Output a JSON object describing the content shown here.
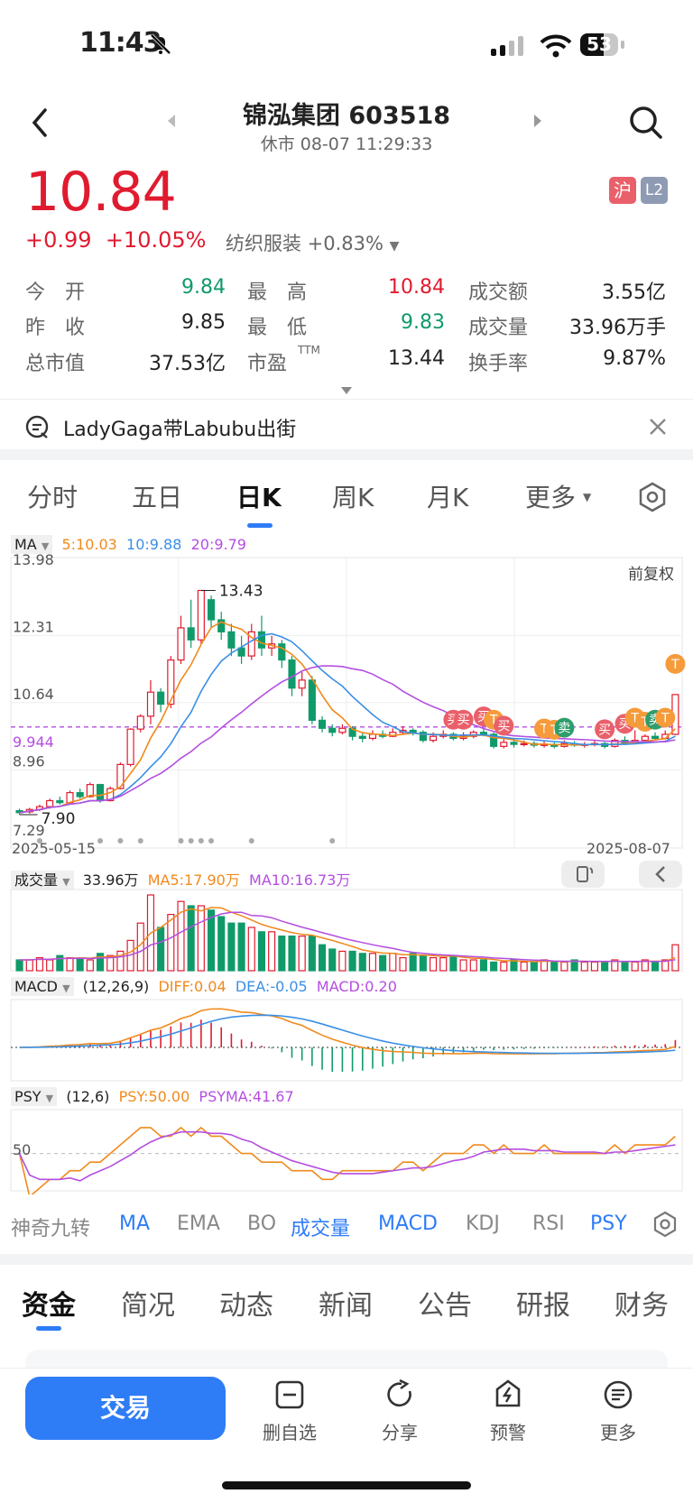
{
  "status": {
    "time": "11:43",
    "battery": "53"
  },
  "header": {
    "title": "锦泓集团 603518",
    "subtitle": "休市 08-07 11:29:33"
  },
  "quote": {
    "price": "10.84",
    "change": "+0.99",
    "change_pct": "+10.05%",
    "sector": "纺织服装 +0.83%",
    "badge_exchange": "沪",
    "badge_level": "L2",
    "rows": [
      [
        {
          "label": "今　开",
          "value": "9.84",
          "color": "green"
        },
        {
          "label": "最　高",
          "value": "10.84",
          "color": "red"
        },
        {
          "label": "成交额",
          "value": "3.55亿",
          "color": "dark"
        }
      ],
      [
        {
          "label": "昨　收",
          "value": "9.85",
          "color": "dark"
        },
        {
          "label": "最　低",
          "value": "9.83",
          "color": "green"
        },
        {
          "label": "成交量",
          "value": "33.96万手",
          "color": "dark"
        }
      ],
      [
        {
          "label": "总市值",
          "value": "37.53亿",
          "color": "dark"
        },
        {
          "label": "市盈",
          "value": "13.44",
          "color": "dark",
          "sup": "TTM"
        },
        {
          "label": "换手率",
          "value": "9.87%",
          "color": "dark"
        }
      ]
    ]
  },
  "notice": {
    "text": "LadyGaga带Labubu出街"
  },
  "period_tabs": [
    "分时",
    "五日",
    "日K",
    "周K",
    "月K",
    "更多"
  ],
  "active_tab_index": 2,
  "chart_data": {
    "type": "candlestick",
    "x_start": "2025-05-15",
    "x_end": "2025-08-07",
    "ma_legend": {
      "label": "MA",
      "ma5": "5:10.03",
      "ma10": "10:9.88",
      "ma20": "20:9.79"
    },
    "adjust_label": "前复权",
    "y_ticks": [
      "13.98",
      "12.31",
      "10.64",
      "8.96",
      "7.29"
    ],
    "prev_close_label": "9.944",
    "high_label": "13.43",
    "low_label": "7.90",
    "ylim": [
      7.29,
      13.98
    ],
    "candles": [
      [
        7.95,
        7.9,
        8.0,
        7.85
      ],
      [
        7.92,
        7.98,
        8.02,
        7.88
      ],
      [
        7.98,
        8.05,
        8.1,
        7.94
      ],
      [
        8.05,
        8.2,
        8.25,
        8.0
      ],
      [
        8.2,
        8.15,
        8.3,
        8.1
      ],
      [
        8.15,
        8.4,
        8.45,
        8.12
      ],
      [
        8.4,
        8.3,
        8.5,
        8.25
      ],
      [
        8.3,
        8.6,
        8.65,
        8.28
      ],
      [
        8.6,
        8.2,
        8.62,
        8.15
      ],
      [
        8.2,
        8.5,
        8.55,
        8.18
      ],
      [
        8.5,
        9.1,
        9.15,
        8.48
      ],
      [
        9.1,
        9.98,
        10.0,
        9.05
      ],
      [
        9.98,
        10.3,
        10.35,
        9.9
      ],
      [
        10.3,
        10.9,
        11.2,
        10.1
      ],
      [
        10.9,
        10.6,
        11.0,
        10.4
      ],
      [
        10.6,
        11.7,
        11.8,
        10.5
      ],
      [
        11.7,
        12.5,
        12.8,
        11.6
      ],
      [
        12.5,
        12.2,
        13.2,
        12.0
      ],
      [
        12.2,
        13.43,
        13.43,
        12.1
      ],
      [
        13.2,
        12.7,
        13.3,
        12.5
      ],
      [
        12.7,
        12.4,
        12.9,
        12.2
      ],
      [
        12.4,
        12.0,
        12.6,
        11.8
      ],
      [
        12.0,
        11.8,
        12.3,
        11.6
      ],
      [
        11.8,
        12.4,
        12.6,
        11.7
      ],
      [
        12.4,
        12.0,
        12.8,
        11.8
      ],
      [
        12.0,
        12.1,
        12.3,
        11.8
      ],
      [
        12.1,
        11.7,
        12.2,
        11.5
      ],
      [
        11.7,
        11.0,
        11.8,
        10.8
      ],
      [
        11.0,
        11.2,
        11.4,
        10.8
      ],
      [
        11.2,
        10.2,
        11.3,
        10.1
      ],
      [
        10.2,
        10.0,
        10.3,
        9.9
      ],
      [
        10.0,
        9.9,
        10.1,
        9.8
      ],
      [
        9.9,
        10.0,
        10.1,
        9.85
      ],
      [
        10.0,
        9.8,
        10.05,
        9.7
      ],
      [
        9.8,
        9.75,
        9.9,
        9.65
      ],
      [
        9.75,
        9.85,
        9.95,
        9.7
      ],
      [
        9.85,
        9.8,
        9.95,
        9.75
      ],
      [
        9.8,
        9.9,
        10.0,
        9.78
      ],
      [
        9.9,
        9.95,
        10.05,
        9.85
      ],
      [
        9.95,
        9.9,
        10.0,
        9.82
      ],
      [
        9.9,
        9.7,
        9.95,
        9.65
      ],
      [
        9.7,
        9.8,
        9.9,
        9.65
      ],
      [
        9.8,
        9.85,
        9.95,
        9.75
      ],
      [
        9.85,
        9.75,
        9.9,
        9.7
      ],
      [
        9.75,
        9.8,
        9.9,
        9.7
      ],
      [
        9.8,
        9.9,
        9.95,
        9.75
      ],
      [
        9.9,
        9.85,
        9.98,
        9.8
      ],
      [
        9.85,
        9.55,
        9.9,
        9.5
      ],
      [
        9.55,
        9.65,
        9.75,
        9.5
      ],
      [
        9.65,
        9.6,
        9.7,
        9.52
      ],
      [
        9.6,
        9.62,
        9.7,
        9.55
      ],
      [
        9.62,
        9.58,
        9.68,
        9.52
      ],
      [
        9.58,
        9.6,
        9.68,
        9.52
      ],
      [
        9.6,
        9.55,
        9.65,
        9.5
      ],
      [
        9.55,
        9.62,
        9.7,
        9.52
      ],
      [
        9.62,
        9.58,
        9.68,
        9.54
      ],
      [
        9.58,
        9.6,
        9.66,
        9.52
      ],
      [
        9.6,
        9.62,
        9.7,
        9.55
      ],
      [
        9.62,
        9.55,
        9.66,
        9.5
      ],
      [
        9.55,
        9.7,
        9.75,
        9.52
      ],
      [
        9.7,
        9.62,
        9.8,
        9.58
      ],
      [
        9.62,
        9.7,
        9.95,
        9.6
      ],
      [
        9.7,
        9.8,
        9.85,
        9.65
      ],
      [
        9.8,
        9.75,
        9.9,
        9.7
      ],
      [
        9.75,
        9.85,
        9.95,
        9.72
      ],
      [
        9.85,
        10.84,
        10.84,
        9.83
      ]
    ],
    "trade_markers": [
      {
        "i": 43,
        "label": "买",
        "color": "#e9606a"
      },
      {
        "i": 44,
        "label": "买",
        "color": "#e9606a"
      },
      {
        "i": 46,
        "label": "买",
        "color": "#e9606a"
      },
      {
        "i": 47,
        "label": "T",
        "color": "#f59b3b"
      },
      {
        "i": 48,
        "label": "买",
        "color": "#e9606a"
      },
      {
        "i": 52,
        "label": "T",
        "color": "#f59b3b"
      },
      {
        "i": 53,
        "label": "T",
        "color": "#f59b3b"
      },
      {
        "i": 54,
        "label": "卖",
        "color": "#2e9e6b"
      },
      {
        "i": 58,
        "label": "买",
        "color": "#e9606a"
      },
      {
        "i": 60,
        "label": "买",
        "color": "#e9606a"
      },
      {
        "i": 61,
        "label": "T",
        "color": "#f59b3b"
      },
      {
        "i": 62,
        "label": "T",
        "color": "#f59b3b"
      },
      {
        "i": 63,
        "label": "卖",
        "color": "#2e9e6b"
      },
      {
        "i": 64,
        "label": "T",
        "color": "#f59b3b"
      },
      {
        "i": 65,
        "label": "T",
        "color": "#f59b3b"
      }
    ]
  },
  "volume": {
    "label": "成交量",
    "value": "33.96万",
    "ma5": "MA5:17.90万",
    "ma10": "MA10:16.73万",
    "bars": [
      5,
      5,
      6,
      5,
      7,
      6,
      6,
      5,
      8,
      7,
      9,
      14,
      22,
      35,
      20,
      26,
      32,
      30,
      30,
      28,
      25,
      22,
      22,
      20,
      18,
      18,
      16,
      16,
      16,
      16,
      12,
      10,
      9,
      9,
      8,
      8,
      7,
      8,
      6,
      8,
      7,
      6,
      6,
      7,
      5,
      5,
      5,
      4,
      4,
      5,
      4,
      4,
      5,
      4,
      4,
      5,
      4,
      4,
      4,
      5,
      4,
      4,
      5,
      4,
      5,
      12
    ]
  },
  "macd": {
    "label": "MACD",
    "params": "(12,26,9)",
    "diff": "DIFF:0.04",
    "dea": "DEA:-0.05",
    "value": "MACD:0.20"
  },
  "psy": {
    "label": "PSY",
    "params": "(12,6)",
    "psy_value": "PSY:50.00",
    "psyma_value": "PSYMA:41.67",
    "ref_line": "50"
  },
  "indicator_tabs": [
    "神奇九转",
    "MA",
    "EMA",
    "BOLL",
    "成交量",
    "MACD",
    "KDJ",
    "RSI",
    "PSY"
  ],
  "section_tabs": [
    "资金",
    "简况",
    "动态",
    "新闻",
    "公告",
    "研报",
    "财务"
  ],
  "bottom_bar": {
    "trade": "交易",
    "items": [
      {
        "icon": "minus-box-icon",
        "label": "删自选"
      },
      {
        "icon": "share-icon",
        "label": "分享"
      },
      {
        "icon": "alert-icon",
        "label": "预警"
      },
      {
        "icon": "more-icon",
        "label": "更多"
      }
    ]
  },
  "colors": {
    "up": "#e01b2f",
    "down": "#109a6a",
    "ma5": "#f08a1c",
    "ma10": "#3a8fe6",
    "ma20": "#b44ee0",
    "accent": "#2e7cf6"
  }
}
